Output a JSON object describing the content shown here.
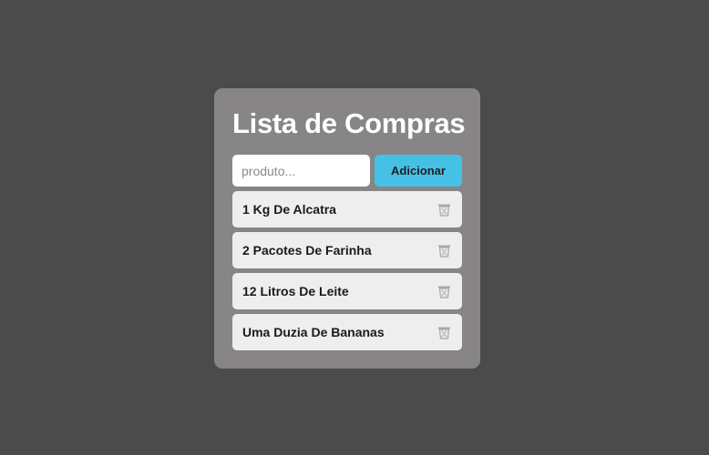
{
  "app": {
    "title": "Lista de Compras"
  },
  "form": {
    "input_value": "",
    "input_placeholder": "produto...",
    "add_label": "Adicionar"
  },
  "list": {
    "items": [
      {
        "label": "1 Kg De Alcatra",
        "icon": "trash-icon"
      },
      {
        "label": "2 Pacotes De Farinha",
        "icon": "trash-icon"
      },
      {
        "label": "12 Litros De Leite",
        "icon": "trash-icon"
      },
      {
        "label": "Uma Duzia De Bananas",
        "icon": "trash-icon"
      }
    ]
  },
  "colors": {
    "background": "#4b4b4b",
    "card": "#878586",
    "accent": "#46c1e6",
    "item_background": "#eeeeee"
  }
}
